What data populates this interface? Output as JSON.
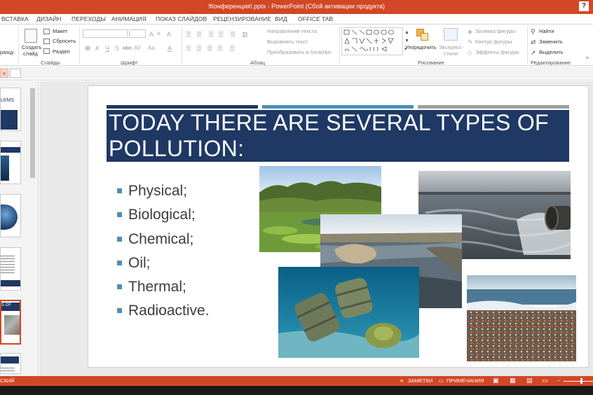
{
  "window": {
    "title": "!Конференция!.pptx - PowerPoint (Сбой активации продукта)",
    "help_label": "?"
  },
  "tabs": [
    {
      "label": "ВСТАВКА"
    },
    {
      "label": "ДИЗАЙН"
    },
    {
      "label": "ПЕРЕХОДЫ"
    },
    {
      "label": "АНИМАЦИЯ"
    },
    {
      "label": "ПОКАЗ СЛАЙДОВ"
    },
    {
      "label": "РЕЦЕНЗИРОВАНИЕ"
    },
    {
      "label": "ВИД"
    },
    {
      "label": "OFFICE TAB"
    }
  ],
  "ribbon": {
    "clipboard": {
      "format_label": "разцу"
    },
    "slides": {
      "new_slide_line1": "Создать",
      "new_slide_line2": "слайд",
      "layout": "Макет",
      "reset": "Сбросить",
      "section": "Раздел",
      "group_label": "Слайды"
    },
    "font": {
      "bold": "Ж",
      "italic": "К",
      "underline": "Ч",
      "shadow": "S",
      "strike": "abc",
      "spacing": "AV",
      "case": "Aa",
      "color": "A",
      "grow": "A",
      "shrink": "A",
      "clear": "A",
      "group_label": "Шрифт"
    },
    "paragraph": {
      "text_direction": "Направление текста",
      "align_text": "Выровнять текст",
      "smartart": "Преобразовать в SmartArt",
      "group_label": "Абзац"
    },
    "drawing": {
      "arrange": "Упорядочить",
      "quick_styles_line1": "Экспресс-",
      "quick_styles_line2": "стили",
      "fill": "Заливка фигуры",
      "outline": "Контур фигуры",
      "effects": "Эффекты фигуры",
      "group_label": "Рисование"
    },
    "editing": {
      "find": "Найти",
      "replace": "Заменить",
      "select": "Выделить",
      "group_label": "Редактирование"
    }
  },
  "thumbnails": [
    {
      "text": "LEMS"
    },
    {
      "text": ""
    },
    {
      "text": ""
    },
    {
      "text": ""
    },
    {
      "text": "S OF"
    },
    {
      "text": ""
    }
  ],
  "slide": {
    "title": "TODAY THERE ARE SEVERAL TYPES OF POLLUTION:",
    "bullets": [
      {
        "text": "Physical;"
      },
      {
        "text": "Biological;"
      },
      {
        "text": "Chemical;"
      },
      {
        "text": "Oil;"
      },
      {
        "text": "Thermal;"
      },
      {
        "text": "Radioactive."
      }
    ],
    "colors": {
      "title_bg": "#1f3864",
      "bar_1": "#1f3864",
      "bar_2": "#4a8fb8",
      "bar_3": "#9e9e9e",
      "bullet": "#4a8fb8"
    }
  },
  "status": {
    "language": "СКИЙ",
    "notes": "ЗАМЕТКИ",
    "comments": "ПРИМЕЧАНИЯ"
  },
  "colors": {
    "accent": "#d24726"
  }
}
